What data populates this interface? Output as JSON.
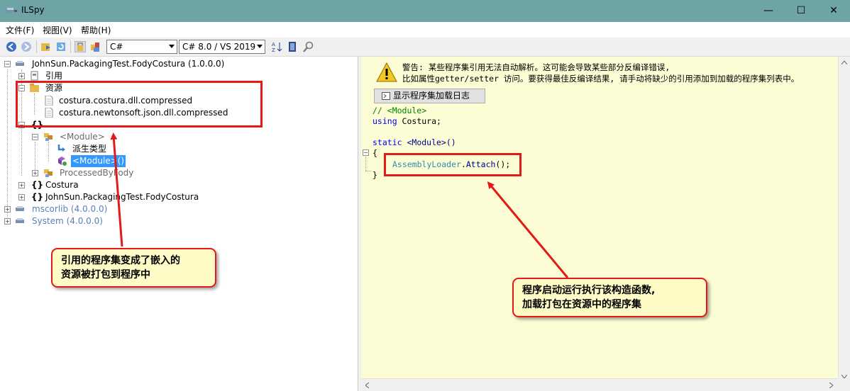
{
  "window": {
    "title": "ILSpy",
    "minimize": "—",
    "maximize": "☐",
    "close": "✕"
  },
  "menu": [
    "文件(F)",
    "视图(V)",
    "帮助(H)"
  ],
  "toolbar": {
    "language": "C#",
    "version": "C# 8.0 / VS 2019"
  },
  "tree": {
    "assembly": "JohnSun.PackagingTest.FodyCostura (1.0.0.0)",
    "references": "引用",
    "resources": "资源",
    "resource1": "costura.costura.dll.compressed",
    "resource2": "costura.newtonsoft.json.dll.compressed",
    "empty_ns": "{}",
    "module": "<Module>",
    "derived_types": "派生类型",
    "module_ctor": "<Module>()",
    "processed": "ProcessedByFody",
    "ns_costura": "Costura",
    "ns_main": "JohnSun.PackagingTest.FodyCostura",
    "mscorlib": "mscorlib (4.0.0.0)",
    "system": "System (4.0.0.0)"
  },
  "code": {
    "warning_line1": "警告: 某些程序集引用无法自动解析。这可能会导致某些部分反编译错误,",
    "warning_line2": "比如属性getter/setter 访问。要获得最佳反编译结果, 请手动将缺少的引用添加到加载的程序集列表中。",
    "show_log_button": "显示程序集加载日志",
    "comment": "// <Module>",
    "using_kw": "using",
    "using_ns": " Costura;",
    "static_kw": "static",
    "ctor_sig": " <Module>()",
    "open_brace": "{",
    "call_type": "AssemblyLoader",
    "call_dot": ".",
    "call_method": "Attach",
    "call_end": "();",
    "close_brace": "}"
  },
  "annotations": {
    "callout_left_line1": "引用的程序集变成了嵌入的",
    "callout_left_line2": "资源被打包到程序中",
    "callout_right_line1": "程序启动运行执行该构造函数,",
    "callout_right_line2": "加载打包在资源中的程序集"
  },
  "colors": {
    "titlebar": "#6fa4a5",
    "code_background": "#fcfcd5",
    "annotation_red": "#e21a1a",
    "callout_fill": "#fffbc6",
    "selection": "#3399ff"
  }
}
